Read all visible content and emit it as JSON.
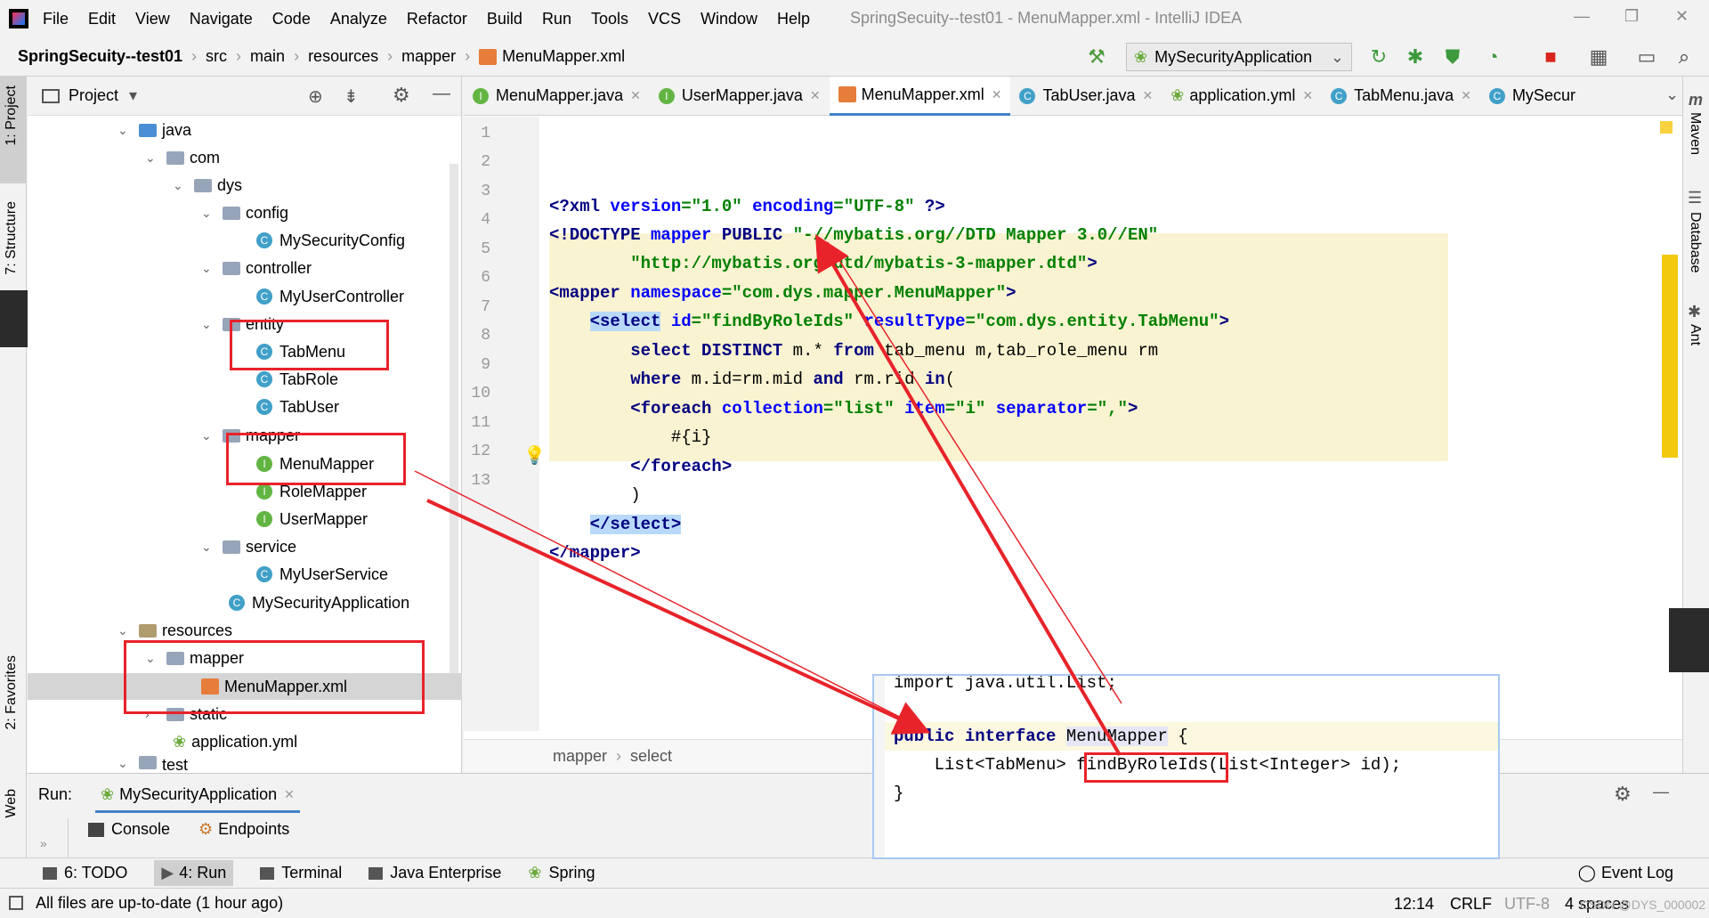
{
  "menubar": {
    "items": [
      "File",
      "Edit",
      "View",
      "Navigate",
      "Code",
      "Analyze",
      "Refactor",
      "Build",
      "Run",
      "Tools",
      "VCS",
      "Window",
      "Help"
    ],
    "title": "SpringSecuity--test01 - MenuMapper.xml - IntelliJ IDEA"
  },
  "navbar": {
    "crumbs": [
      "SpringSecuity--test01",
      "src",
      "main",
      "resources",
      "mapper",
      "MenuMapper.xml"
    ],
    "run_config": "MySecurityApplication"
  },
  "left_strip": {
    "project": "1: Project",
    "structure": "7: Structure",
    "favorites": "2: Favorites",
    "web": "Web"
  },
  "right_strip": {
    "maven": "Maven",
    "database": "Database",
    "ant": "Ant"
  },
  "project": {
    "title": "Project",
    "tree": [
      "java",
      "com",
      "dys",
      "config",
      "MySecurityConfig",
      "controller",
      "MyUserController",
      "entity",
      "TabMenu",
      "TabRole",
      "TabUser",
      "mapper",
      "MenuMapper",
      "RoleMapper",
      "UserMapper",
      "service",
      "MyUserService",
      "MySecurityApplication",
      "resources",
      "mapper",
      "MenuMapper.xml",
      "static",
      "application.yml",
      "test"
    ]
  },
  "tabs": [
    "MenuMapper.java",
    "UserMapper.java",
    "MenuMapper.xml",
    "TabUser.java",
    "application.yml",
    "TabMenu.java",
    "MySecur"
  ],
  "code": {
    "line_numbers": [
      "1",
      "2",
      "3",
      "4",
      "5",
      "6",
      "7",
      "8",
      "9",
      "10",
      "11",
      "12",
      "13"
    ]
  },
  "breadcrumb": {
    "a": "mapper",
    "b": "select"
  },
  "run": {
    "label": "Run:",
    "config": "MySecurityApplication",
    "console": "Console",
    "endpoints": "Endpoints"
  },
  "bottom_tabs": [
    "6: TODO",
    "4: Run",
    "Terminal",
    "Java Enterprise",
    "Spring"
  ],
  "event_log": "Event Log",
  "status": {
    "message": "All files are up-to-date (1 hour ago)",
    "position": "12:14",
    "line_sep": "CRLF",
    "encoding": "UTF-8",
    "indent": "4 spaces",
    "watermark": "CSDN @DYS_000002"
  },
  "popup": {
    "line1": "import java.util.List;",
    "line2_kw": "public interface",
    "line2_name": "MenuMapper",
    "line2_brace": " {",
    "line3_a": "    List<TabMenu> ",
    "line3_m": "findByRoleIds",
    "line3_b": "(List<Integer> id);",
    "line4": "}"
  }
}
